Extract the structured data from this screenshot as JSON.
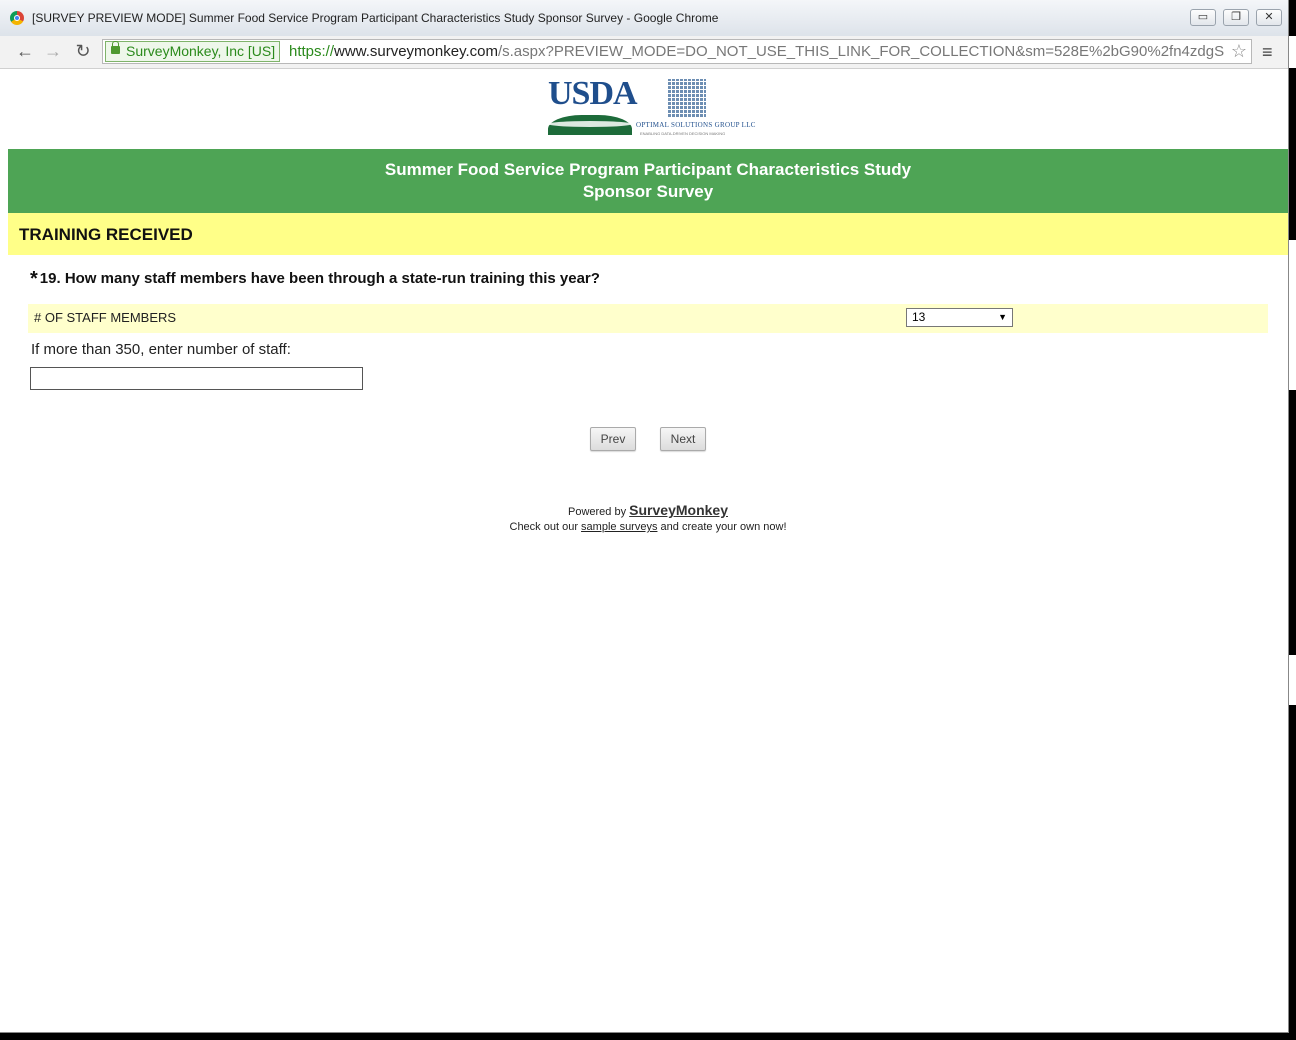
{
  "window": {
    "title": "[SURVEY PREVIEW MODE] Summer Food Service Program Participant Characteristics Study Sponsor Survey - Google Chrome",
    "minimize": "▭",
    "restore": "❐",
    "close": "✕"
  },
  "toolbar": {
    "back": "←",
    "forward": "→",
    "reload": "↻",
    "ev_cert": "SurveyMonkey, Inc [US]",
    "url_scheme": "https://",
    "url_host": "www.surveymonkey.com",
    "url_rest": "/s.aspx?PREVIEW_MODE=DO_NOT_USE_THIS_LINK_FOR_COLLECTION&sm=528E%2bG90%2fn4zdgS",
    "star": "☆",
    "menu": "≡"
  },
  "logos": {
    "usda": "USDA",
    "osg": "OPTIMAL SOLUTIONS GROUP LLC",
    "osg_sub": "ENABLING DATA-DRIVEN DECISION MAKING"
  },
  "banner": {
    "line1": "Summer Food Service Program Participant Characteristics Study",
    "line2": "Sponsor Survey"
  },
  "section": {
    "title": "TRAINING RECEIVED"
  },
  "question": {
    "required_mark": "*",
    "text": "19. How many staff members have been through a state-run training this year?",
    "row_label": "# OF STAFF MEMBERS",
    "selected_value": "13",
    "select_arrow": "▼",
    "more_label": "If more than 350, enter number of staff:",
    "more_value": ""
  },
  "nav": {
    "prev": "Prev",
    "next": "Next"
  },
  "footer": {
    "powered_by": "Powered by",
    "brand": "SurveyMonkey",
    "check_prefix": "Check out our",
    "check_link": "sample surveys",
    "check_suffix": "and create your own now!"
  }
}
